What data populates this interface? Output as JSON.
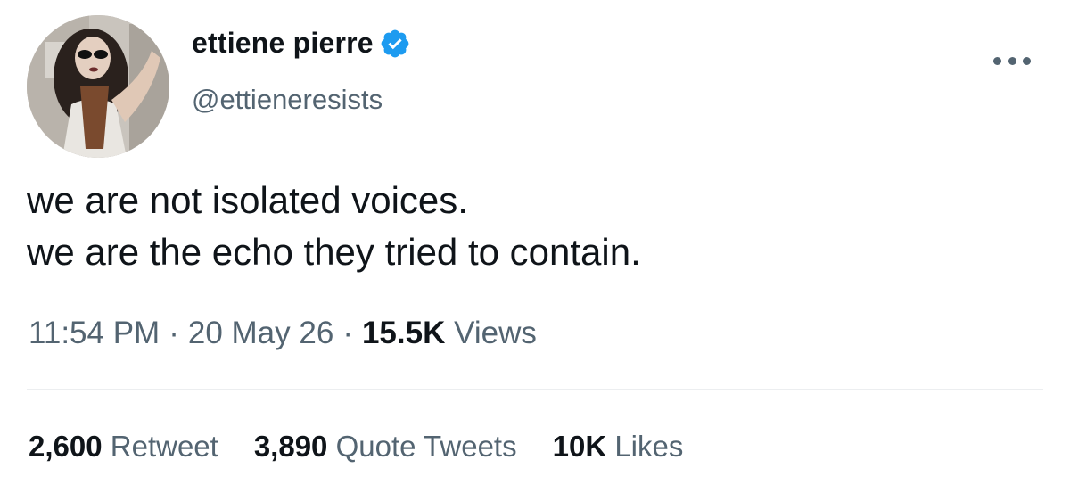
{
  "user": {
    "display_name": "ettiene pierre",
    "handle": "@ettieneresists",
    "verified": true,
    "avatar_icon": "profile-photo"
  },
  "tweet": {
    "lines": [
      "we are not isolated voices.",
      "we are the echo they tried to contain."
    ]
  },
  "meta": {
    "time": "11:54 PM",
    "separator": "·",
    "date": "20 May 26",
    "views_count": "15.5K",
    "views_label": "Views"
  },
  "stats": {
    "retweets_count": "2,600",
    "retweets_label": "Retweet",
    "quotes_count": "3,890",
    "quotes_label": "Quote Tweets",
    "likes_count": "10K",
    "likes_label": "Likes"
  },
  "colors": {
    "text_primary": "#0f1419",
    "text_secondary": "#536471",
    "verified_blue": "#1d9bf0",
    "divider": "#eceef0"
  }
}
